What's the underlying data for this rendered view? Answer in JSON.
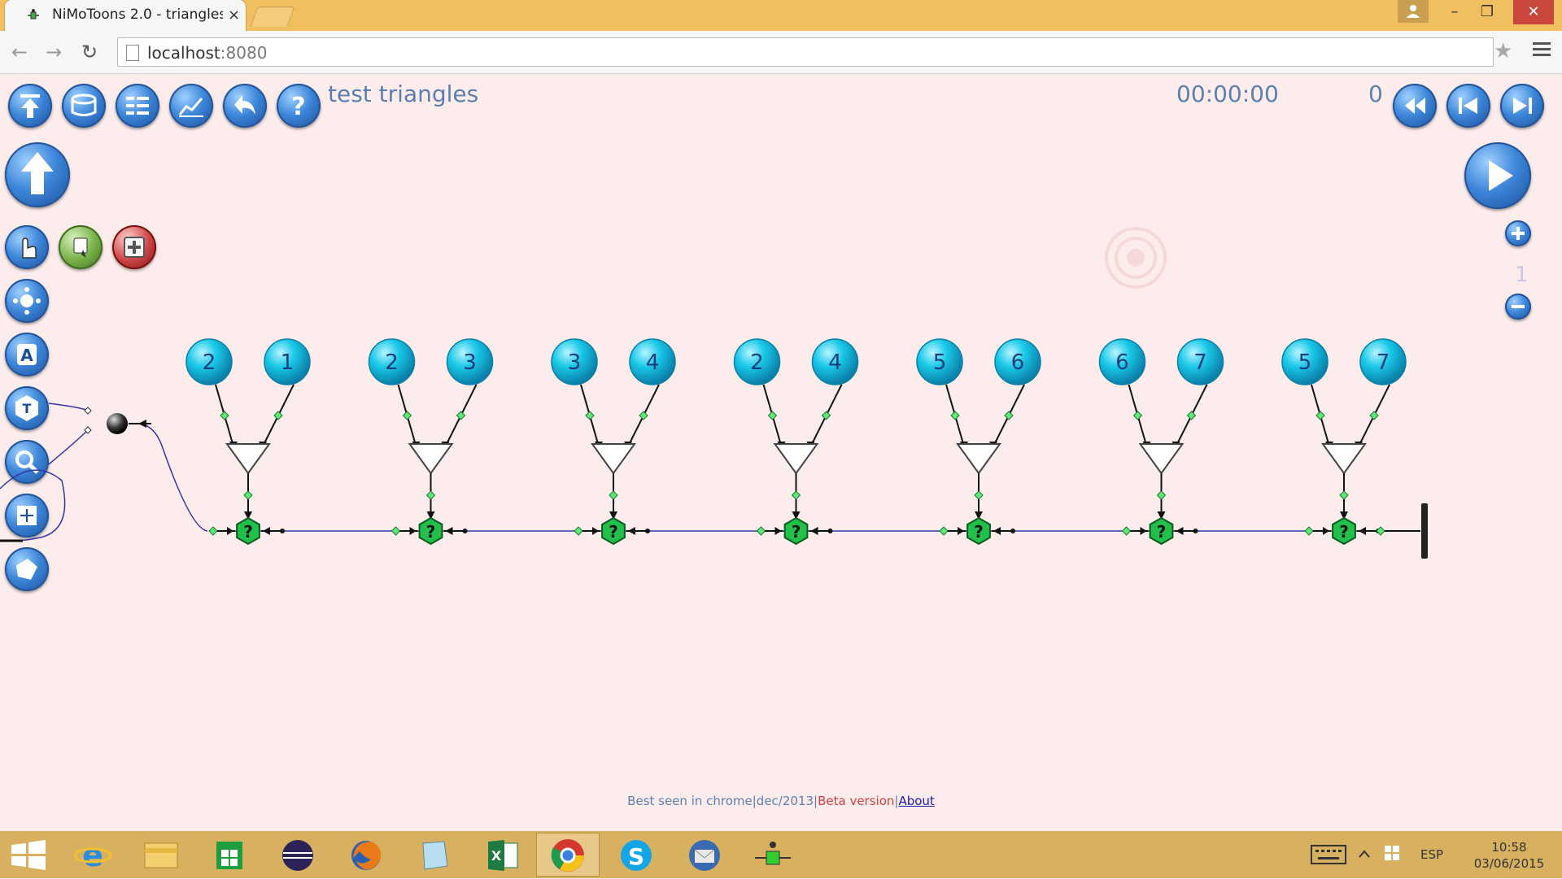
{
  "browser": {
    "tab_title": "NiMoToons 2.0 - triangles",
    "tab_close": "×",
    "url_host": "localhost",
    "url_port": ":8080",
    "window_controls": {
      "minimize": "–",
      "maximize": "❐",
      "close": "✕"
    }
  },
  "app": {
    "title": "test triangles",
    "timer": "00:00:00",
    "frame": "0",
    "zoom_level": "1",
    "toolbar_icons": [
      "upload-icon",
      "database-icon",
      "list-icon",
      "chart-icon",
      "undo-icon",
      "help-icon"
    ],
    "playback_icons": [
      "rewind-icon",
      "previous-icon",
      "next-icon",
      "play-icon"
    ],
    "left_tools": [
      "hand-icon",
      "node-icon",
      "add-icon",
      "move-icon",
      "text-tool-icon",
      "type-icon",
      "magnify-icon",
      "zoom-fit-icon",
      "tag-icon"
    ]
  },
  "graph": {
    "pairs": [
      {
        "left": "2",
        "right": "1"
      },
      {
        "left": "2",
        "right": "3"
      },
      {
        "left": "3",
        "right": "4"
      },
      {
        "left": "2",
        "right": "4"
      },
      {
        "left": "5",
        "right": "6"
      },
      {
        "left": "6",
        "right": "7"
      },
      {
        "left": "5",
        "right": "7"
      }
    ],
    "question_symbol": "?"
  },
  "footer": {
    "best_seen": "Best seen in chrome|dec/2013|",
    "beta": "Beta version",
    "sep": "|",
    "about": "About"
  },
  "taskbar": {
    "apps": [
      "windows-start-icon",
      "internet-explorer-icon",
      "file-explorer-icon",
      "store-icon",
      "eclipse-icon",
      "firefox-icon",
      "notepad-icon",
      "excel-icon",
      "chrome-icon",
      "skype-icon",
      "thunderbird-icon",
      "network-app-icon"
    ],
    "lang": "ESP",
    "time": "10:58",
    "date": "03/06/2015"
  },
  "colors": {
    "title_bar": "#f0c060",
    "app_bg": "#fdecec",
    "accent_text": "#5b7fb0",
    "node_cyan": "#19c8e8",
    "hex_green": "#22c04a"
  }
}
